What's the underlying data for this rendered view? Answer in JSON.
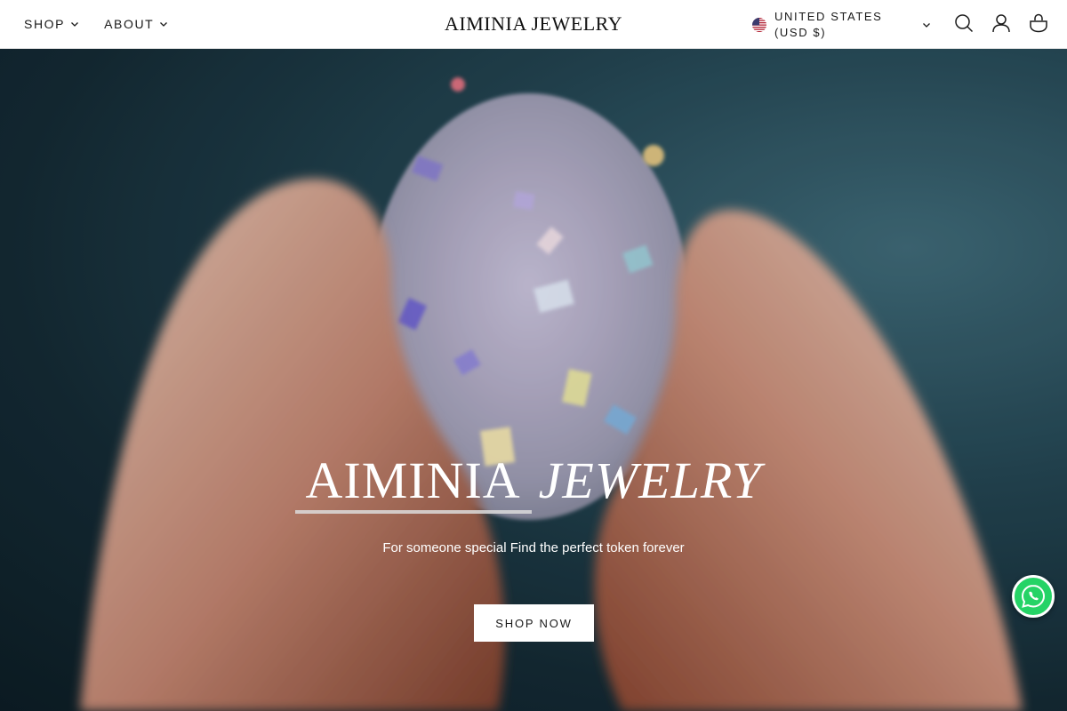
{
  "header": {
    "nav": [
      {
        "label": "SHOP"
      },
      {
        "label": "ABOUT"
      }
    ],
    "logo": "AIMINIA JEWELRY",
    "region": {
      "label": "UNITED STATES (USD $)",
      "flag_icon": "us-flag-icon"
    },
    "icons": [
      "search-icon",
      "account-icon",
      "cart-icon"
    ]
  },
  "hero": {
    "title_word1": "AIMINIA",
    "title_word2": "JEWELRY",
    "subtitle": "For someone special Find the perfect token forever",
    "cta_label": "SHOP NOW"
  },
  "whatsapp": {
    "icon": "whatsapp-icon",
    "color": "#25d366"
  }
}
